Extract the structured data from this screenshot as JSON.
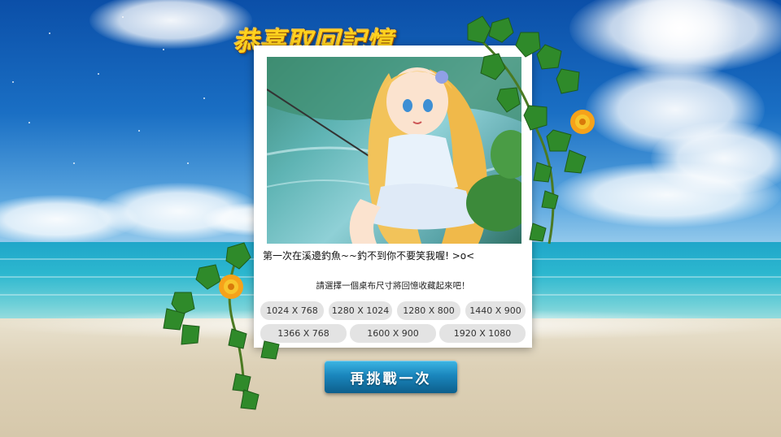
{
  "title": "恭喜取回記憶",
  "memory": {
    "caption": "第一次在溪邊釣魚~~釣不到你不要笑我喔! >o<",
    "hint": "請選擇一個桌布尺寸將回憶收藏起來吧！"
  },
  "wallpaper_sizes": [
    [
      "1024 X 768",
      "1280 X 1024",
      "1280 X 800",
      "1440 X 900"
    ],
    [
      "1366 X 768",
      "1600 X 900",
      "1920 X 1080"
    ]
  ],
  "retry_label": "再挑戰一次",
  "colors": {
    "title": "#ffd21e",
    "retry_button": "#1a86bd",
    "size_button": "#e3e3e3",
    "card": "#ffffff"
  },
  "icons": [
    "ivy-vine-decoration",
    "marigold-flower-icon"
  ]
}
